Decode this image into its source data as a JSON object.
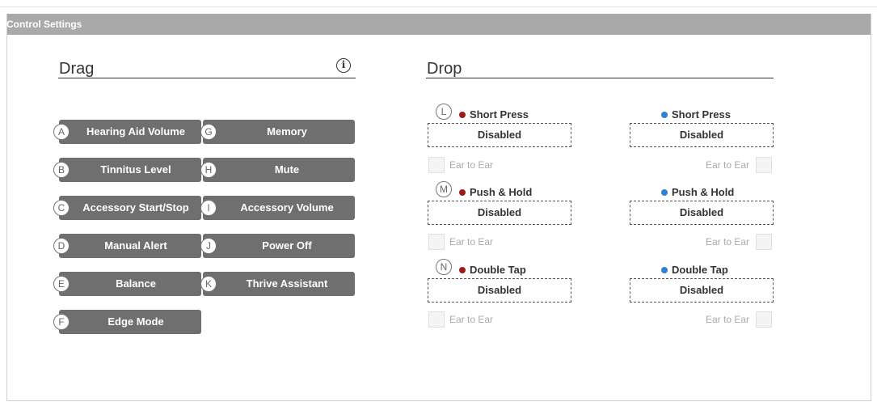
{
  "panel": {
    "title": "Control Settings"
  },
  "drag": {
    "title": "Drag",
    "info_icon": "i",
    "buttons": [
      {
        "letter": "A",
        "label": "Hearing Aid Volume"
      },
      {
        "letter": "G",
        "label": "Memory"
      },
      {
        "letter": "B",
        "label": "Tinnitus Level"
      },
      {
        "letter": "H",
        "label": "Mute"
      },
      {
        "letter": "C",
        "label": "Accessory Start/Stop"
      },
      {
        "letter": "I",
        "label": "Accessory Volume"
      },
      {
        "letter": "D",
        "label": "Manual Alert"
      },
      {
        "letter": "J",
        "label": "Power Off"
      },
      {
        "letter": "E",
        "label": "Balance"
      },
      {
        "letter": "K",
        "label": "Thrive Assistant"
      },
      {
        "letter": "F",
        "label": "Edge Mode"
      }
    ]
  },
  "drop": {
    "title": "Drop",
    "left_color": "#9b1c1c",
    "right_color": "#2f7fd0",
    "rows": [
      {
        "letter": "L",
        "left_label": "Short Press",
        "right_label": "Short Press",
        "left_value": "Disabled",
        "right_value": "Disabled",
        "left_e2e": "Ear to Ear",
        "right_e2e": "Ear to Ear"
      },
      {
        "letter": "M",
        "left_label": "Push & Hold",
        "right_label": "Push & Hold",
        "left_value": "Disabled",
        "right_value": "Disabled",
        "left_e2e": "Ear to Ear",
        "right_e2e": "Ear to Ear"
      },
      {
        "letter": "N",
        "left_label": "Double Tap",
        "right_label": "Double Tap",
        "left_value": "Disabled",
        "right_value": "Disabled",
        "left_e2e": "Ear to Ear",
        "right_e2e": "Ear to Ear"
      }
    ]
  }
}
